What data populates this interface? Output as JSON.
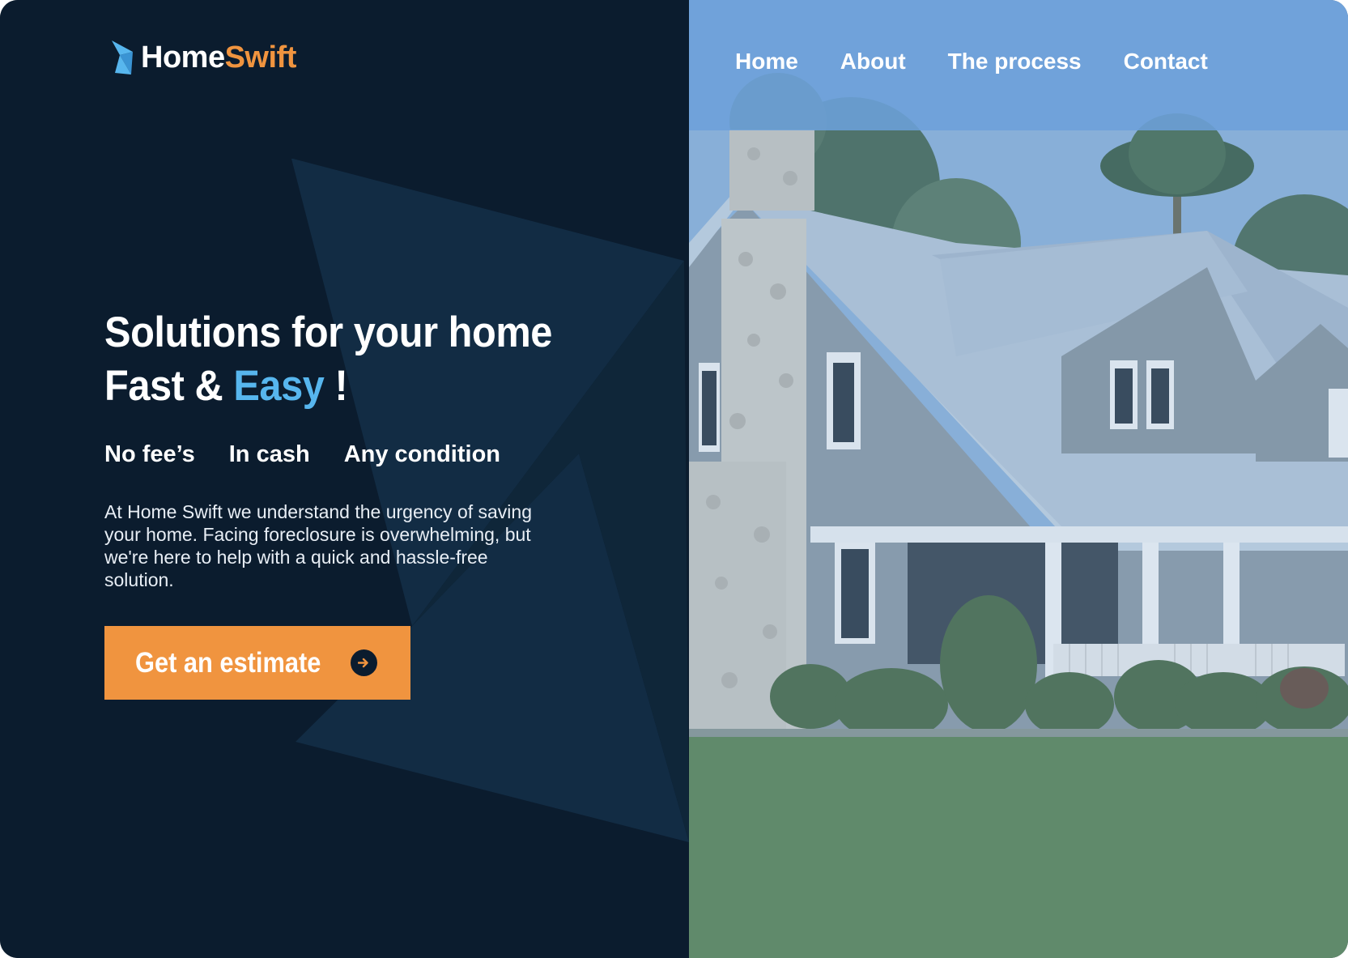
{
  "brand": {
    "name_part1": "Home",
    "name_part2": "Swift",
    "color_dark": "#0b1c2e",
    "color_accent_orange": "#f0943f",
    "color_accent_blue": "#57b6ee"
  },
  "nav": {
    "items": [
      {
        "label": "Home"
      },
      {
        "label": "About"
      },
      {
        "label": "The process"
      },
      {
        "label": "Contact"
      }
    ]
  },
  "hero": {
    "title_line1": "Solutions for your home",
    "title_line2_prefix": "Fast & ",
    "title_line2_accent": "Easy",
    "title_line2_suffix": " !",
    "features": [
      "No fee’s",
      "In cash",
      "Any condition"
    ],
    "description": "At Home Swift we understand the urgency of saving your home. Facing foreclosure is overwhelming, but we're here to help with a quick and hassle-free solution.",
    "cta_label": "Get an estimate",
    "cta_icon": "arrow-right-circle-icon"
  },
  "media": {
    "hero_image": "craftsman-house-photo"
  }
}
